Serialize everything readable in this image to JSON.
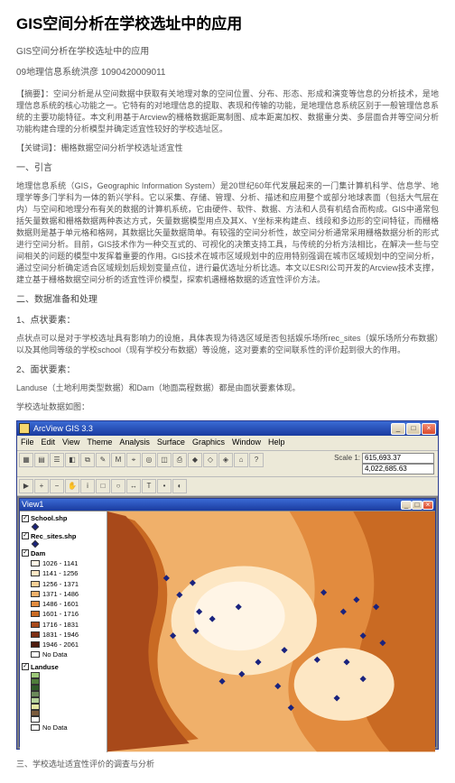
{
  "title": "GIS空间分析在学校选址中的应用",
  "subtitle": "GIS空间分析在学校选址中的应用",
  "author": "09地理信息系统洪彦 1090420009011",
  "abstract_label": "【摘要】",
  "abstract_text": "：空间分析是从空间数据中获取有关地理对象的空间位置、分布、形态、形成和演变等信息的分析技术，是地理信息系统的核心功能之一。它特有的对地理信息的提取、表现和传输的功能，是地理信息系统区别于一般管理信息系统的主要功能特征。本文利用基于Arcview的栅格数据距离制图、成本距离加权、数据重分类、多层面合并等空间分析功能构建合理的分析模型并确定适宜性较好的学校选址区。",
  "keywords_label": "【关键词】",
  "keywords_text": "：栅格数据空间分析学校选址适宜性",
  "sections": {
    "s1_head": "一、引言",
    "s1_p": "地理信息系统（GIS，Geographic Information System）是20世纪60年代发展起来的一门集计算机科学、信息学、地理学等多门学科为一体的新兴学科。它以采集、存储、管理、分析、描述和应用整个或部分地球表面（包括大气层在内）与空间和地理分布有关的数据的计算机系统，它由硬件、软件、数据、方法和人员有机结合而构成。GIS中通常包括矢量数据和栅格数据两种表达方式，矢量数据模型用点及其X、Y坐标来构建点、线段和多边形的空间特征，而栅格数据则是基于单元格和格网，其数据比矢量数据简单。有较强的空间分析性，故空间分析通常采用栅格数据分析的形式进行空间分析。目前，GIS技术作为一种交互式的、可视化的决策支持工具，与传统的分析方法相比，在解决一些与空间相关的问题的模型中发挥着重要的作用。GIS技术在城市区域规划中的应用特别强调在城市区域规划中的空间分析，通过空间分析确定适合区域规划后规划变量点位，进行最优选址分析比选。本文以ESRI公司开发的Arcview技术支撑，建立基于栅格数据空间分析的适宜性评价模型，探索机遇栅格数据的适宜性评价方法。",
    "s2_head": "二、数据准备和处理",
    "s2_1_head": "1、点状要素：",
    "s2_1_p": "点状点可以是对于学校选址具有影响力的设施，具体表现为待选区域是否包括娱乐场所rec_sites（娱乐场所分布数据）以及其他同等级的学校school（现有学校分布数据）等设施，这对要素的空间联系性的评价起到很大的作用。",
    "s2_2_head": "2、面状要素：",
    "s2_2_p": "Landuse（土地利用类型数据）和Dam（地面高程数据）都是由面状要素体现。",
    "s2_3_p": "学校选址数据如图：",
    "s3_head": "三、学校选址适宜性评价的调查与分析"
  },
  "arcview": {
    "app_title": "ArcView GIS 3.3",
    "menus": [
      "File",
      "Edit",
      "View",
      "Theme",
      "Analysis",
      "Surface",
      "Graphics",
      "Window",
      "Help"
    ],
    "scale_label": "Scale 1:",
    "scale_value": "",
    "coord_value": "4,022,685.63",
    "coord_top": "615,693.37",
    "view_title": "View1",
    "layers": {
      "school": {
        "name": "School.shp"
      },
      "rec": {
        "name": "Rec_sites.shp"
      },
      "dam": {
        "name": "Dam",
        "classes": [
          {
            "label": "1026 - 1141",
            "color": "#fff5e6"
          },
          {
            "label": "1141 - 1256",
            "color": "#fde7c4"
          },
          {
            "label": "1256 - 1371",
            "color": "#f8cf96"
          },
          {
            "label": "1371 - 1486",
            "color": "#f0b06a"
          },
          {
            "label": "1486 - 1601",
            "color": "#e28b3e"
          },
          {
            "label": "1601 - 1716",
            "color": "#c96a23"
          },
          {
            "label": "1716 - 1831",
            "color": "#a8491a"
          },
          {
            "label": "1831 - 1946",
            "color": "#7d2f14"
          },
          {
            "label": "1946 - 2061",
            "color": "#4f1c0e"
          },
          {
            "label": "No Data",
            "color": "#ffffff"
          }
        ]
      },
      "landuse": {
        "name": "Landuse",
        "classes": [
          {
            "color": "#9ec97a"
          },
          {
            "color": "#4f7d3b"
          },
          {
            "color": "#2f5a28"
          },
          {
            "color": "#6b895a"
          },
          {
            "color": "#b5d39b"
          },
          {
            "color": "#e5e8a3"
          },
          {
            "color": "#7a5b3c"
          },
          {
            "color": "#ffffff"
          }
        ],
        "nodata_label": "No Data"
      }
    }
  },
  "chart_data": {
    "type": "area",
    "title": "Dam DEM with school/rec_sites points",
    "xlabel": "",
    "ylabel": "",
    "dem_value_range": [
      1026,
      2061
    ],
    "schools_xy": [
      [
        0.18,
        0.28
      ],
      [
        0.22,
        0.35
      ],
      [
        0.26,
        0.3
      ],
      [
        0.28,
        0.42
      ],
      [
        0.27,
        0.5
      ],
      [
        0.32,
        0.45
      ],
      [
        0.2,
        0.52
      ],
      [
        0.4,
        0.4
      ],
      [
        0.35,
        0.71
      ],
      [
        0.41,
        0.68
      ],
      [
        0.46,
        0.63
      ],
      [
        0.52,
        0.73
      ],
      [
        0.56,
        0.82
      ],
      [
        0.54,
        0.58
      ]
    ],
    "rec_sites_xy": [
      [
        0.66,
        0.34
      ],
      [
        0.72,
        0.42
      ],
      [
        0.76,
        0.37
      ],
      [
        0.82,
        0.4
      ],
      [
        0.78,
        0.52
      ],
      [
        0.84,
        0.55
      ],
      [
        0.73,
        0.63
      ],
      [
        0.78,
        0.7
      ],
      [
        0.7,
        0.78
      ],
      [
        0.64,
        0.62
      ]
    ]
  }
}
